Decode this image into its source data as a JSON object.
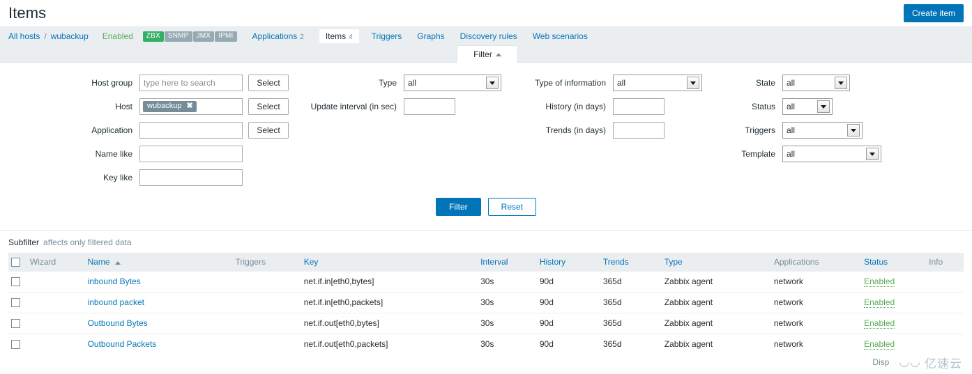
{
  "header": {
    "title": "Items",
    "create_button": "Create item"
  },
  "breadcrumb": {
    "all_hosts": "All hosts",
    "separator": "/",
    "host": "wubackup",
    "status": "Enabled",
    "interfaces": [
      {
        "label": "ZBX",
        "active": true
      },
      {
        "label": "SNMP",
        "active": false
      },
      {
        "label": "JMX",
        "active": false
      },
      {
        "label": "IPMI",
        "active": false
      }
    ],
    "nav": [
      {
        "label": "Applications",
        "count": "2",
        "selected": false
      },
      {
        "label": "Items",
        "count": "4",
        "selected": true
      },
      {
        "label": "Triggers",
        "count": "",
        "selected": false
      },
      {
        "label": "Graphs",
        "count": "",
        "selected": false
      },
      {
        "label": "Discovery rules",
        "count": "",
        "selected": false
      },
      {
        "label": "Web scenarios",
        "count": "",
        "selected": false
      }
    ]
  },
  "filter": {
    "tab_label": "Filter",
    "host_group": {
      "label": "Host group",
      "value": "",
      "placeholder": "type here to search",
      "select_button": "Select"
    },
    "host": {
      "label": "Host",
      "chip": "wubackup",
      "select_button": "Select"
    },
    "application": {
      "label": "Application",
      "value": "",
      "select_button": "Select"
    },
    "name_like": {
      "label": "Name like",
      "value": ""
    },
    "key_like": {
      "label": "Key like",
      "value": ""
    },
    "type": {
      "label": "Type",
      "value": "all"
    },
    "update_interval": {
      "label": "Update interval (in sec)",
      "value": ""
    },
    "type_of_information": {
      "label": "Type of information",
      "value": "all"
    },
    "history": {
      "label": "History (in days)",
      "value": ""
    },
    "trends": {
      "label": "Trends (in days)",
      "value": ""
    },
    "state": {
      "label": "State",
      "value": "all"
    },
    "status": {
      "label": "Status",
      "value": "all"
    },
    "triggers": {
      "label": "Triggers",
      "value": "all"
    },
    "template": {
      "label": "Template",
      "value": "all"
    },
    "apply_button": "Filter",
    "reset_button": "Reset"
  },
  "subfilter": {
    "title": "Subfilter",
    "note": "affects only filtered data"
  },
  "table": {
    "columns": [
      "Wizard",
      "Name",
      "Triggers",
      "Key",
      "Interval",
      "History",
      "Trends",
      "Type",
      "Applications",
      "Status",
      "Info"
    ],
    "sorted_column": "Name",
    "sort_direction": "asc",
    "rows": [
      {
        "name": "inbound Bytes",
        "triggers": "",
        "key": "net.if.in[eth0,bytes]",
        "interval": "30s",
        "history": "90d",
        "trends": "365d",
        "type": "Zabbix agent",
        "applications": "network",
        "status": "Enabled",
        "info": ""
      },
      {
        "name": "inbound packet",
        "triggers": "",
        "key": "net.if.in[eth0,packets]",
        "interval": "30s",
        "history": "90d",
        "trends": "365d",
        "type": "Zabbix agent",
        "applications": "network",
        "status": "Enabled",
        "info": ""
      },
      {
        "name": "Outbound Bytes",
        "triggers": "",
        "key": "net.if.out[eth0,bytes]",
        "interval": "30s",
        "history": "90d",
        "trends": "365d",
        "type": "Zabbix agent",
        "applications": "network",
        "status": "Enabled",
        "info": ""
      },
      {
        "name": "Outbound Packets",
        "triggers": "",
        "key": "net.if.out[eth0,packets]",
        "interval": "30s",
        "history": "90d",
        "trends": "365d",
        "type": "Zabbix agent",
        "applications": "network",
        "status": "Enabled",
        "info": ""
      }
    ]
  },
  "footer": {
    "displaying_text": "Disp",
    "watermark": "亿速云"
  },
  "colors": {
    "accent": "#0275b8",
    "status_green": "#59ab57",
    "interface_active": "#34af67",
    "interface_inactive": "#97aab3",
    "muted": "#768d99",
    "bar_bg": "#ebeef0"
  }
}
